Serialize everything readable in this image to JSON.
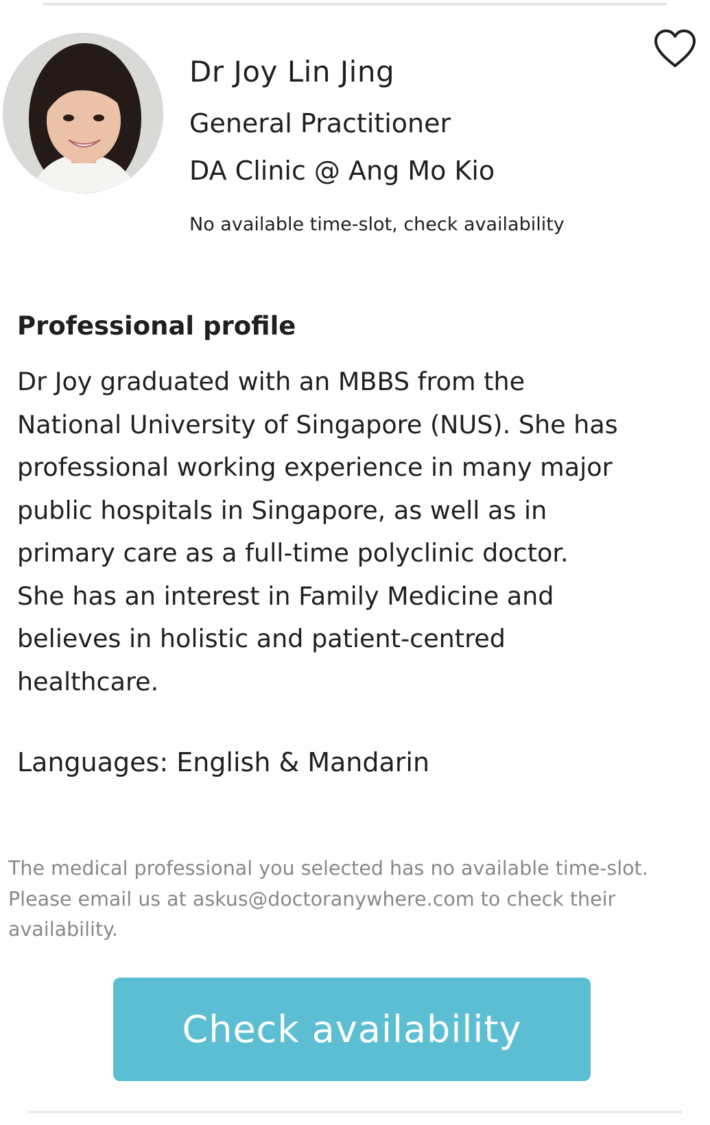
{
  "colors": {
    "accent": "#5bbed3",
    "text": "#1f1f1f",
    "muted": "#888888",
    "divider": "#e6e6e6"
  },
  "doctor": {
    "photo_icon": "doctor-portrait",
    "name": "Dr Joy Lin Jing",
    "specialty": "General Practitioner",
    "clinic": "DA Clinic @ Ang Mo Kio",
    "availability_note": "No available time-slot, check availability",
    "favorite_icon": "heart-outline-icon"
  },
  "profile": {
    "title": "Professional profile",
    "body": "Dr Joy graduated with an MBBS from the\nNational University of Singapore (NUS). She has\nprofessional working experience in many major\npublic hospitals in Singapore, as well as in\nprimary care as a full-time polyclinic doctor.\nShe has an interest in Family Medicine and\nbelieves in holistic and patient-centred\nhealthcare.",
    "languages": "Languages: English & Mandarin"
  },
  "footer": {
    "note": "The medical professional you selected has no available time-slot.\nPlease email us at askus@doctoranywhere.com to check their\navailability.",
    "button_label": "Check availability"
  }
}
